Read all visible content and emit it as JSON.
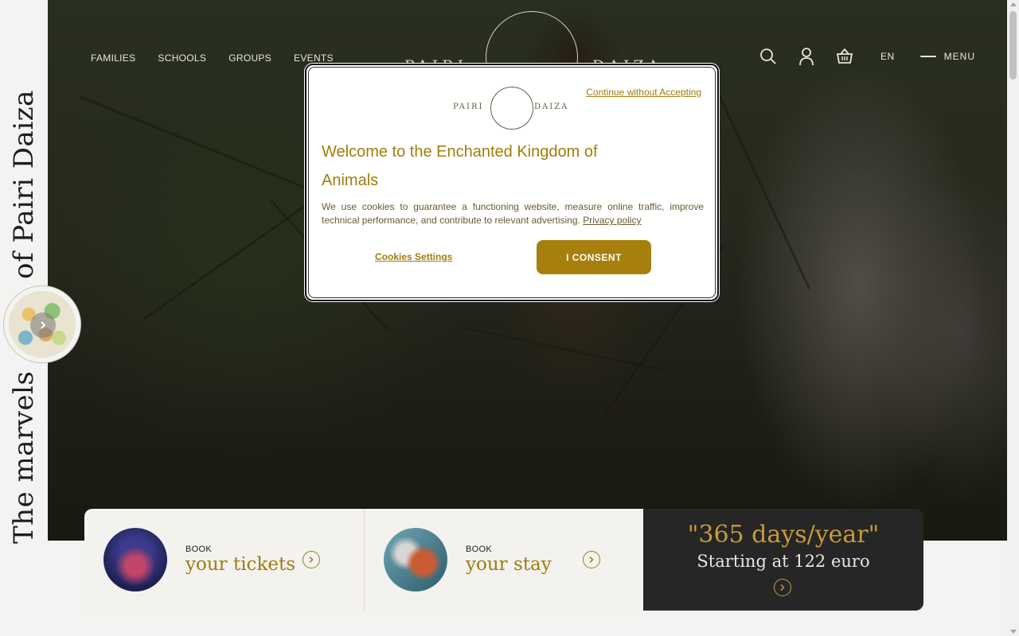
{
  "side": {
    "tagline_top": "of Pairi Daiza",
    "tagline_bottom": "The marvels",
    "map_button_icon": "chevron-right-icon"
  },
  "header": {
    "nav": [
      "FAMILIES",
      "SCHOOLS",
      "GROUPS",
      "EVENTS"
    ],
    "logo_left": "PAIRI",
    "logo_right": "DAIZA",
    "icons": [
      "search-icon",
      "user-icon",
      "basket-icon"
    ],
    "language": "EN",
    "menu_label": "MENU"
  },
  "cookie_modal": {
    "continue_label": "Continue without Accepting",
    "logo_left": "PAIRI",
    "logo_right": "DAIZA",
    "title": "Welcome to the Enchanted Kingdom of Animals",
    "body": "We use cookies to guarantee a functioning website, measure online traffic, improve technical performance, and contribute to relevant advertising.",
    "privacy_link": "Privacy policy",
    "settings_label": "Cookies Settings",
    "consent_label": "I CONSENT",
    "accent_color": "#a17c0b"
  },
  "booking": {
    "cards": [
      {
        "small": "BOOK",
        "big": "your tickets"
      },
      {
        "small": "BOOK",
        "big": "your stay"
      }
    ],
    "promo": {
      "quote": "\"365 days/year\"",
      "subtitle": "Starting at 122 euro"
    }
  }
}
